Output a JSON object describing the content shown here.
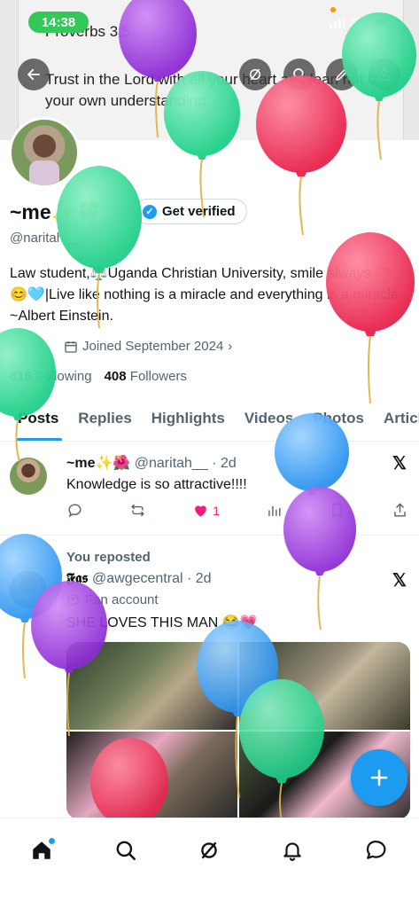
{
  "status_bar": {
    "time": "14:38",
    "network": "5G"
  },
  "banner": {
    "title": "Proverbs 3:5",
    "verse": "Trust in the Lord with all your heart and lean not on your own understanding."
  },
  "profile": {
    "name": "~me",
    "name_emoji": "✨🍀",
    "verify_label": "Get verified",
    "handle": "@naritah__",
    "bio": "Law student,⚖️Uganda Christian University, smile always 🫶😊🩵|Live like nothing is a miracle and everything is a miracle ~Albert Einstein.",
    "joined": "Joined September 2024",
    "following_count": "616",
    "following_label": "Following",
    "followers_count": "408",
    "followers_label": "Followers"
  },
  "tabs": [
    {
      "label": "Posts"
    },
    {
      "label": "Replies"
    },
    {
      "label": "Highlights"
    },
    {
      "label": "Videos"
    },
    {
      "label": "Photos"
    },
    {
      "label": "Articles"
    }
  ],
  "posts": [
    {
      "name": "~me✨🌺",
      "handle": "@naritah__",
      "time": "2d",
      "text": "Knowledge is so attractive!!!!",
      "likes": "1"
    },
    {
      "repost_label": "You reposted",
      "name": "𝕱𝖆𝖘",
      "handle": "@awgecentral",
      "time": "2d",
      "fan_label": "Fan account",
      "text": "SHE LOVES THIS MAN 😂💗"
    }
  ],
  "icons": {
    "back": "back-arrow-icon",
    "grok": "grok-icon",
    "search": "search-icon",
    "edit": "edit-icon",
    "share": "share-icon",
    "compose": "plus-icon"
  },
  "colors": {
    "accent": "#1d9bf0",
    "like": "#f91880",
    "balloon_purple": "#a23be0",
    "balloon_green": "#34d99a",
    "balloon_red": "#f2395d",
    "balloon_blue": "#3aa3f5"
  }
}
